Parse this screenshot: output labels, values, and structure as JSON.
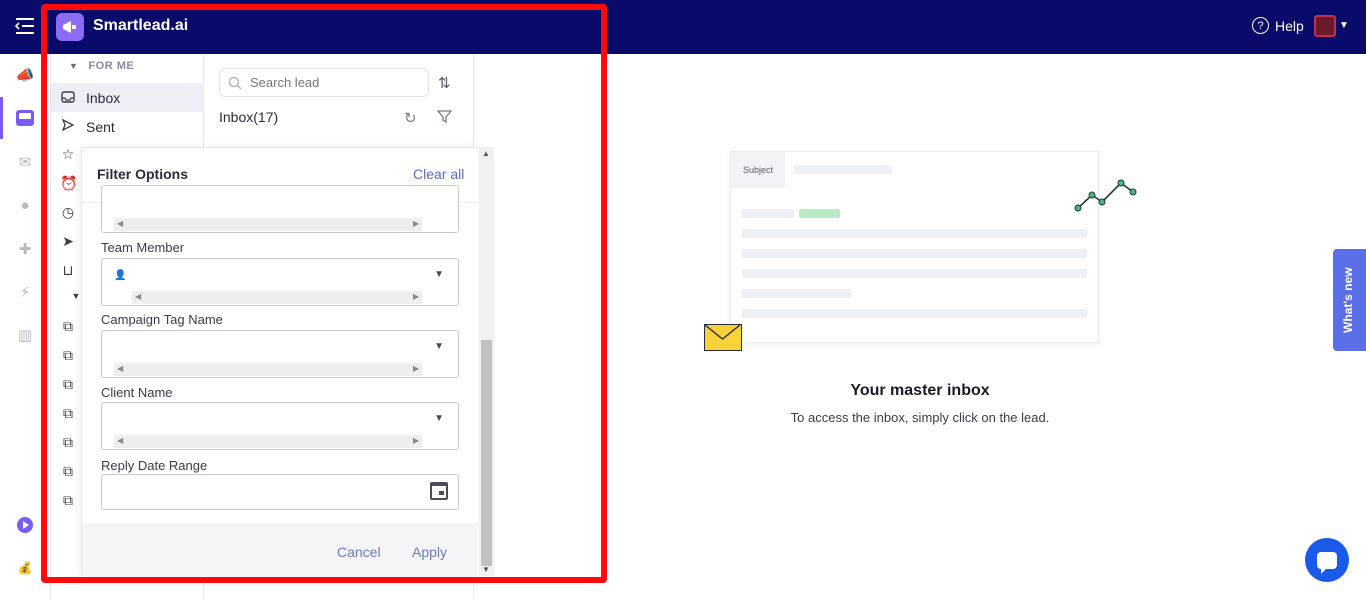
{
  "header": {
    "brand": "Smartlead.ai",
    "help_label": "Help"
  },
  "folders": {
    "section_label": "FOR ME",
    "items": [
      {
        "label": "Inbox",
        "icon": "inbox-icon"
      },
      {
        "label": "Sent",
        "icon": "send-icon"
      }
    ]
  },
  "list": {
    "search_placeholder": "Search lead",
    "inbox_count_label": "Inbox(17)"
  },
  "filter": {
    "title": "Filter Options",
    "clear_all": "Clear all",
    "fields": {
      "team_member": "Team Member",
      "campaign_tag": "Campaign Tag Name",
      "client_name": "Client Name",
      "reply_date_range": "Reply Date Range"
    },
    "cancel_label": "Cancel",
    "apply_label": "Apply"
  },
  "empty_state": {
    "subject_tab": "Subject",
    "title": "Your master inbox",
    "subtitle": "To access the inbox, simply click on the lead."
  },
  "whats_new": "What's new",
  "colors": {
    "topbar": "#0a0a6a",
    "accent": "#7a5af5",
    "highlight": "#ff0a0a",
    "chat": "#1a5ae8"
  }
}
